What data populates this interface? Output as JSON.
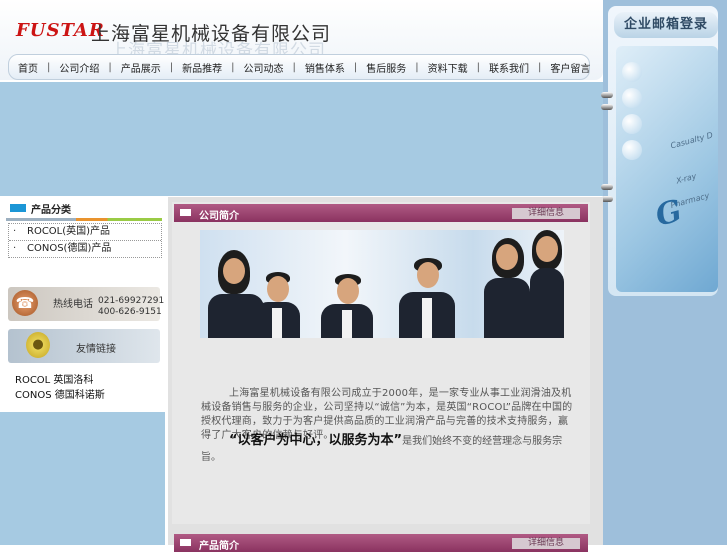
{
  "header": {
    "logo": "FUSTAR",
    "company_name": "上海富星机械设备有限公司"
  },
  "nav": {
    "items": [
      "首页",
      "公司介绍",
      "产品展示",
      "新品推荐",
      "公司动态",
      "销售体系",
      "售后服务",
      "资料下载",
      "联系我们",
      "客户留言"
    ],
    "separator": "|"
  },
  "mail": {
    "title": "企业邮箱登录",
    "deco": [
      "Casualty D",
      "X-ray",
      "Pharmacy"
    ],
    "letter": "G"
  },
  "sidebar": {
    "category_title": "产品分类",
    "categories": [
      {
        "bullet": "·",
        "label": "ROCOL(英国)产品"
      },
      {
        "bullet": "·",
        "label": "CONOS(德国)产品"
      }
    ],
    "hotline_label": "热线电话",
    "hotline_numbers": [
      "021-69927291",
      "400-626-9151"
    ],
    "links_label": "友情链接",
    "links": [
      "ROCOL 英国洛科",
      "CONOS 德国科诺斯"
    ]
  },
  "main": {
    "about_title": "公司简介",
    "about_more": "详细信息",
    "intro_paragraph1": "上海富星机械设备有限公司成立于2000年，是一家专业从事工业润滑油及机械设备销售与服务的企业，公司坚持以“诚信”为本，是英国“ROCOL”品牌在中国的授权代理商，致力于为客户提供高品质的工业润滑产品与完善的技术支持服务，赢得了广大客户的信赖与好评。",
    "intro_paragraph2_brand": "“以客户为中心，以服务为本”",
    "intro_paragraph2_rest": "是我们始终不变的经营理念与服务宗旨。",
    "products_title": "产品简介",
    "products_more": "详细信息"
  },
  "colors": {
    "accent_magenta": "#8a3360",
    "brand_red": "#cc1414",
    "banner_blue": "#a6cae2",
    "right_panel_blue": "#9ebfdb"
  }
}
